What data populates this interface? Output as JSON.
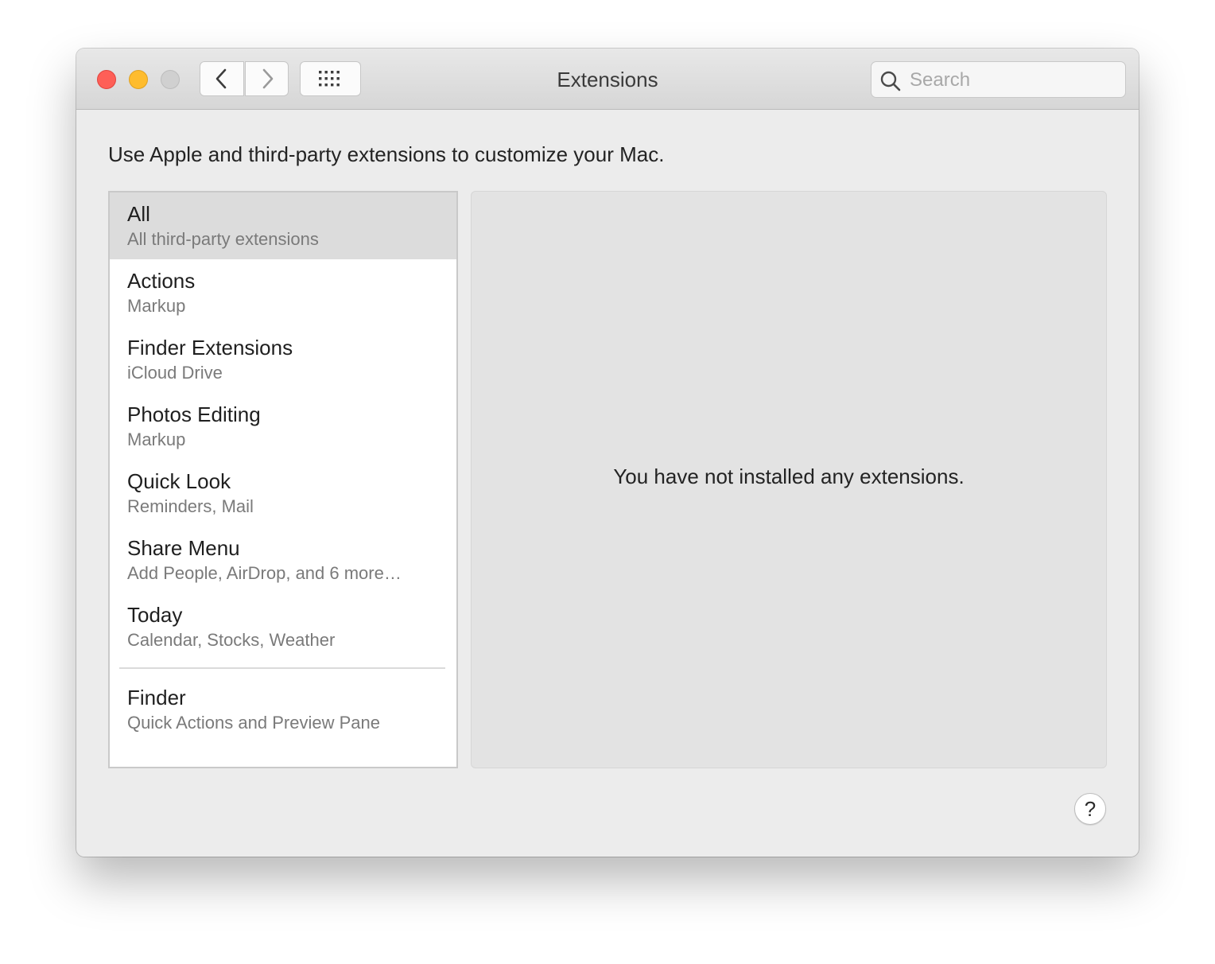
{
  "window": {
    "title": "Extensions"
  },
  "toolbar": {
    "back_icon": "chevron-left-icon",
    "forward_icon": "chevron-right-icon",
    "grid_icon": "grid-icon"
  },
  "search": {
    "placeholder": "Search",
    "value": "",
    "icon": "search-icon"
  },
  "intro_text": "Use Apple and third-party extensions to customize your Mac.",
  "sidebar": {
    "items": [
      {
        "name": "All",
        "sub": "All third-party extensions",
        "selected": true
      },
      {
        "name": "Actions",
        "sub": "Markup"
      },
      {
        "name": "Finder Extensions",
        "sub": "iCloud Drive"
      },
      {
        "name": "Photos Editing",
        "sub": "Markup"
      },
      {
        "name": "Quick Look",
        "sub": "Reminders, Mail"
      },
      {
        "name": "Share Menu",
        "sub": "Add People, AirDrop, and 6 more…"
      },
      {
        "name": "Today",
        "sub": "Calendar, Stocks, Weather"
      },
      {
        "name": "Finder",
        "sub": "Quick Actions and Preview Pane"
      }
    ]
  },
  "content": {
    "empty_message": "You have not installed any extensions."
  },
  "help": {
    "label": "?"
  },
  "colors": {
    "close": "#fe5f57",
    "minimize": "#febc2e",
    "zoom_disabled": "#d0d0d0",
    "selected_row": "#dcdcdc",
    "window_bg": "#ececec"
  }
}
